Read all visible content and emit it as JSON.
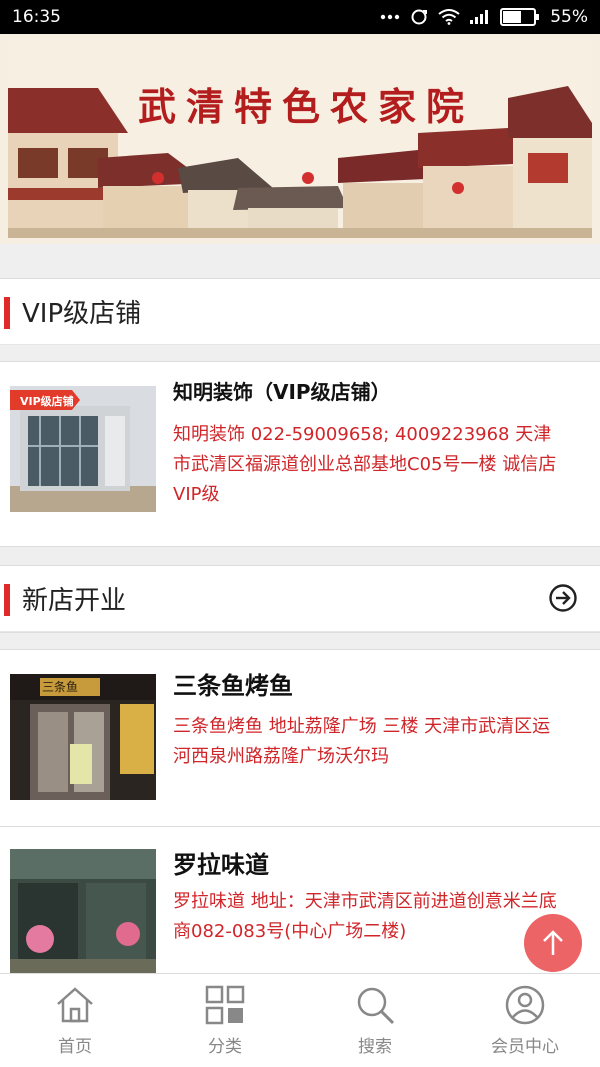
{
  "statusbar": {
    "time": "16:35",
    "battery": "55%"
  },
  "banner": {
    "title": "武清特色农家院"
  },
  "vip_section": {
    "title": "VIP级店铺",
    "items": [
      {
        "title": "知明装饰（VIP级店铺）",
        "badge": "VIP级店铺",
        "desc": "知明装饰 022-59009658; 4009223968 天津市武清区福源道创业总部基地C05号一楼 诚信店 VIP级"
      }
    ]
  },
  "new_section": {
    "title": "新店开业",
    "items": [
      {
        "title": "三条鱼烤鱼",
        "sign": "三条鱼",
        "desc": "三条鱼烤鱼 地址荔隆广场 三楼 天津市武清区运河西泉州路荔隆广场沃尔玛"
      },
      {
        "title": "罗拉味道",
        "desc": "罗拉味道 地址：天津市武清区前进道创意米兰底商082-083号(中心广场二楼)"
      }
    ]
  },
  "nav": [
    {
      "label": "首页",
      "icon": "home-icon"
    },
    {
      "label": "分类",
      "icon": "grid-icon"
    },
    {
      "label": "搜索",
      "icon": "search-icon"
    },
    {
      "label": "会员中心",
      "icon": "user-icon"
    }
  ],
  "colors": {
    "accent": "#e02a2a",
    "desc_text": "#d0262a",
    "fab": "#ec6466"
  }
}
